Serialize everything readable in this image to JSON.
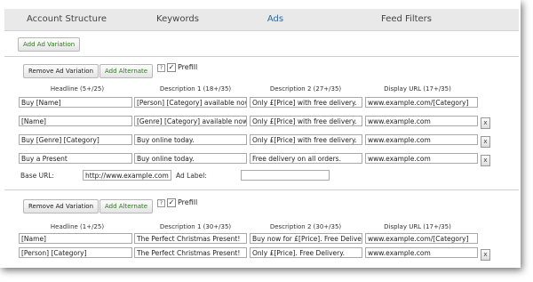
{
  "tabs": [
    "Account Structure",
    "Keywords",
    "Ads",
    "Feed Filters"
  ],
  "add_variation": "Add Ad Variation",
  "remove_variation": "Remove Ad Variation",
  "add_alternate": "Add Alternate",
  "help_glyph": "?",
  "prefill": "Prefill",
  "delete_glyph": "x",
  "block1": {
    "headers": [
      "Headline (5+/25)",
      "Description 1 (18+/35)",
      "Description 2 (27+/35)",
      "Display URL (17+/35)"
    ],
    "rows": [
      [
        "Buy [Name]",
        "[Person] [Category] available now",
        "Only £[Price] with free delivery.",
        "www.example.com/[Category]"
      ],
      [
        "[Name]",
        "[Genre] [Category] available now!",
        "Only £[Price] with free delivery.",
        "www.example.com"
      ],
      [
        "Buy [Genre] [Category]",
        "Buy online today.",
        "Only £[Price] with free delivery.",
        "www.example.com"
      ],
      [
        "Buy a Present",
        "Buy online today.",
        "Free delivery on all orders.",
        "www.example.com"
      ]
    ],
    "base_url_label": "Base URL:",
    "base_url_value": "http://www.example.com",
    "ad_label": "Ad Label:",
    "ad_label_value": ""
  },
  "block2": {
    "headers": [
      "Headline (1+/25)",
      "Description 1 (30+/35)",
      "Description 2 (30+/35)",
      "Display URL (17+/35)"
    ],
    "rows": [
      [
        "[Name]",
        "The Perfect Christmas Present!",
        "Buy now for £[Price]. Free Deliver",
        "www.example.com/[Category]"
      ],
      [
        "[Person] [Category]",
        "The Perfect Christmas Present!",
        "Only £[Price]. Free Delivery.",
        "www.example.com"
      ]
    ]
  }
}
